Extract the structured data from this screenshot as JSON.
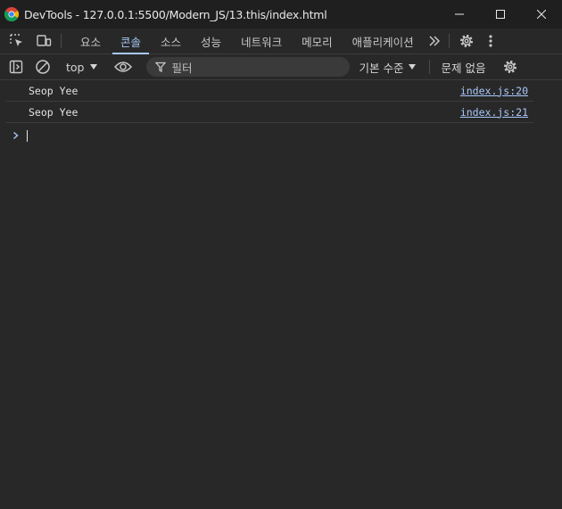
{
  "window": {
    "title": "DevTools - 127.0.0.1:5500/Modern_JS/13.this/index.html"
  },
  "tabs": [
    {
      "label": "요소"
    },
    {
      "label": "콘솔",
      "active": true
    },
    {
      "label": "소스"
    },
    {
      "label": "성능"
    },
    {
      "label": "네트워크"
    },
    {
      "label": "메모리"
    },
    {
      "label": "애플리케이션"
    }
  ],
  "toolbar": {
    "context": "top",
    "filter_placeholder": "필터",
    "level": "기본 수준",
    "issues": "문제 없음"
  },
  "console": {
    "messages": [
      {
        "text": "Seop Yee",
        "source": "index.js:20"
      },
      {
        "text": "Seop Yee",
        "source": "index.js:21"
      }
    ]
  },
  "colors": {
    "accent": "#a8c7fa",
    "background": "#282828",
    "titlebar": "#1f1f1f"
  }
}
